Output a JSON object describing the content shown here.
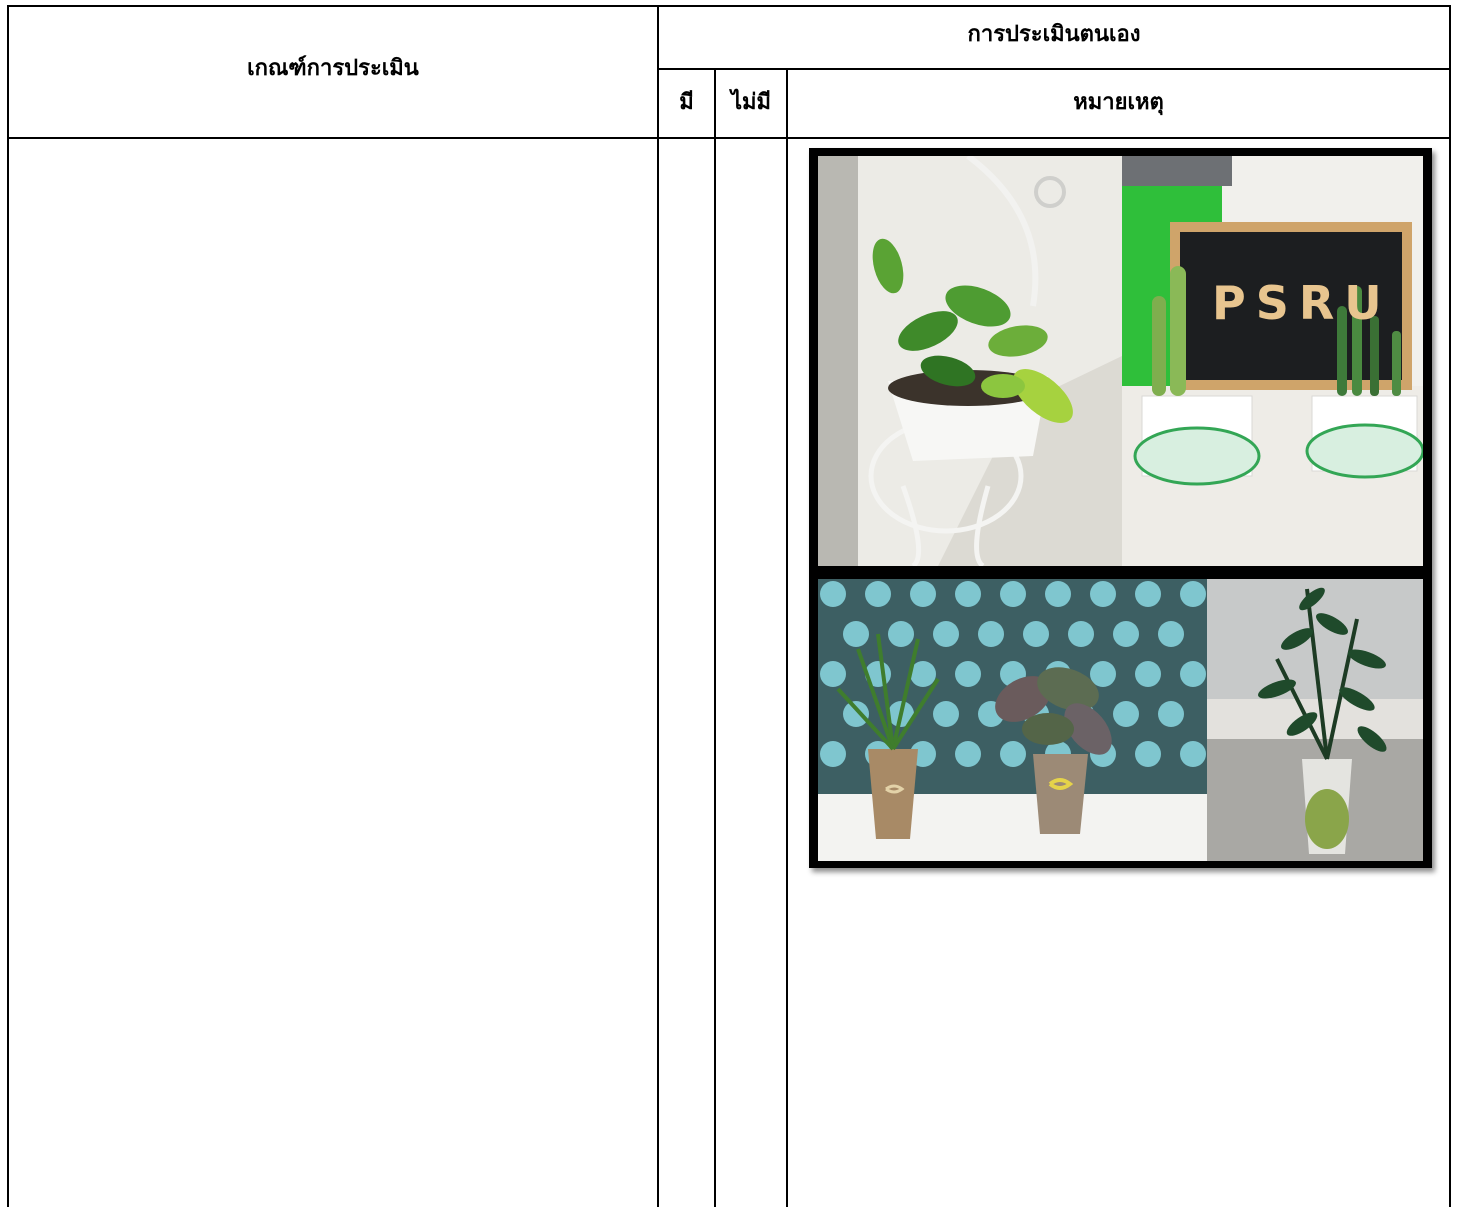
{
  "table": {
    "criteria_header": "เกณฑ์การประเมิน",
    "self_assessment_header": "การประเมินตนเอง",
    "col_yes": "มี",
    "col_no": "ไม่มี",
    "col_remarks": "หมายเหตุ"
  },
  "photos": {
    "sign_text": "PSRU"
  }
}
